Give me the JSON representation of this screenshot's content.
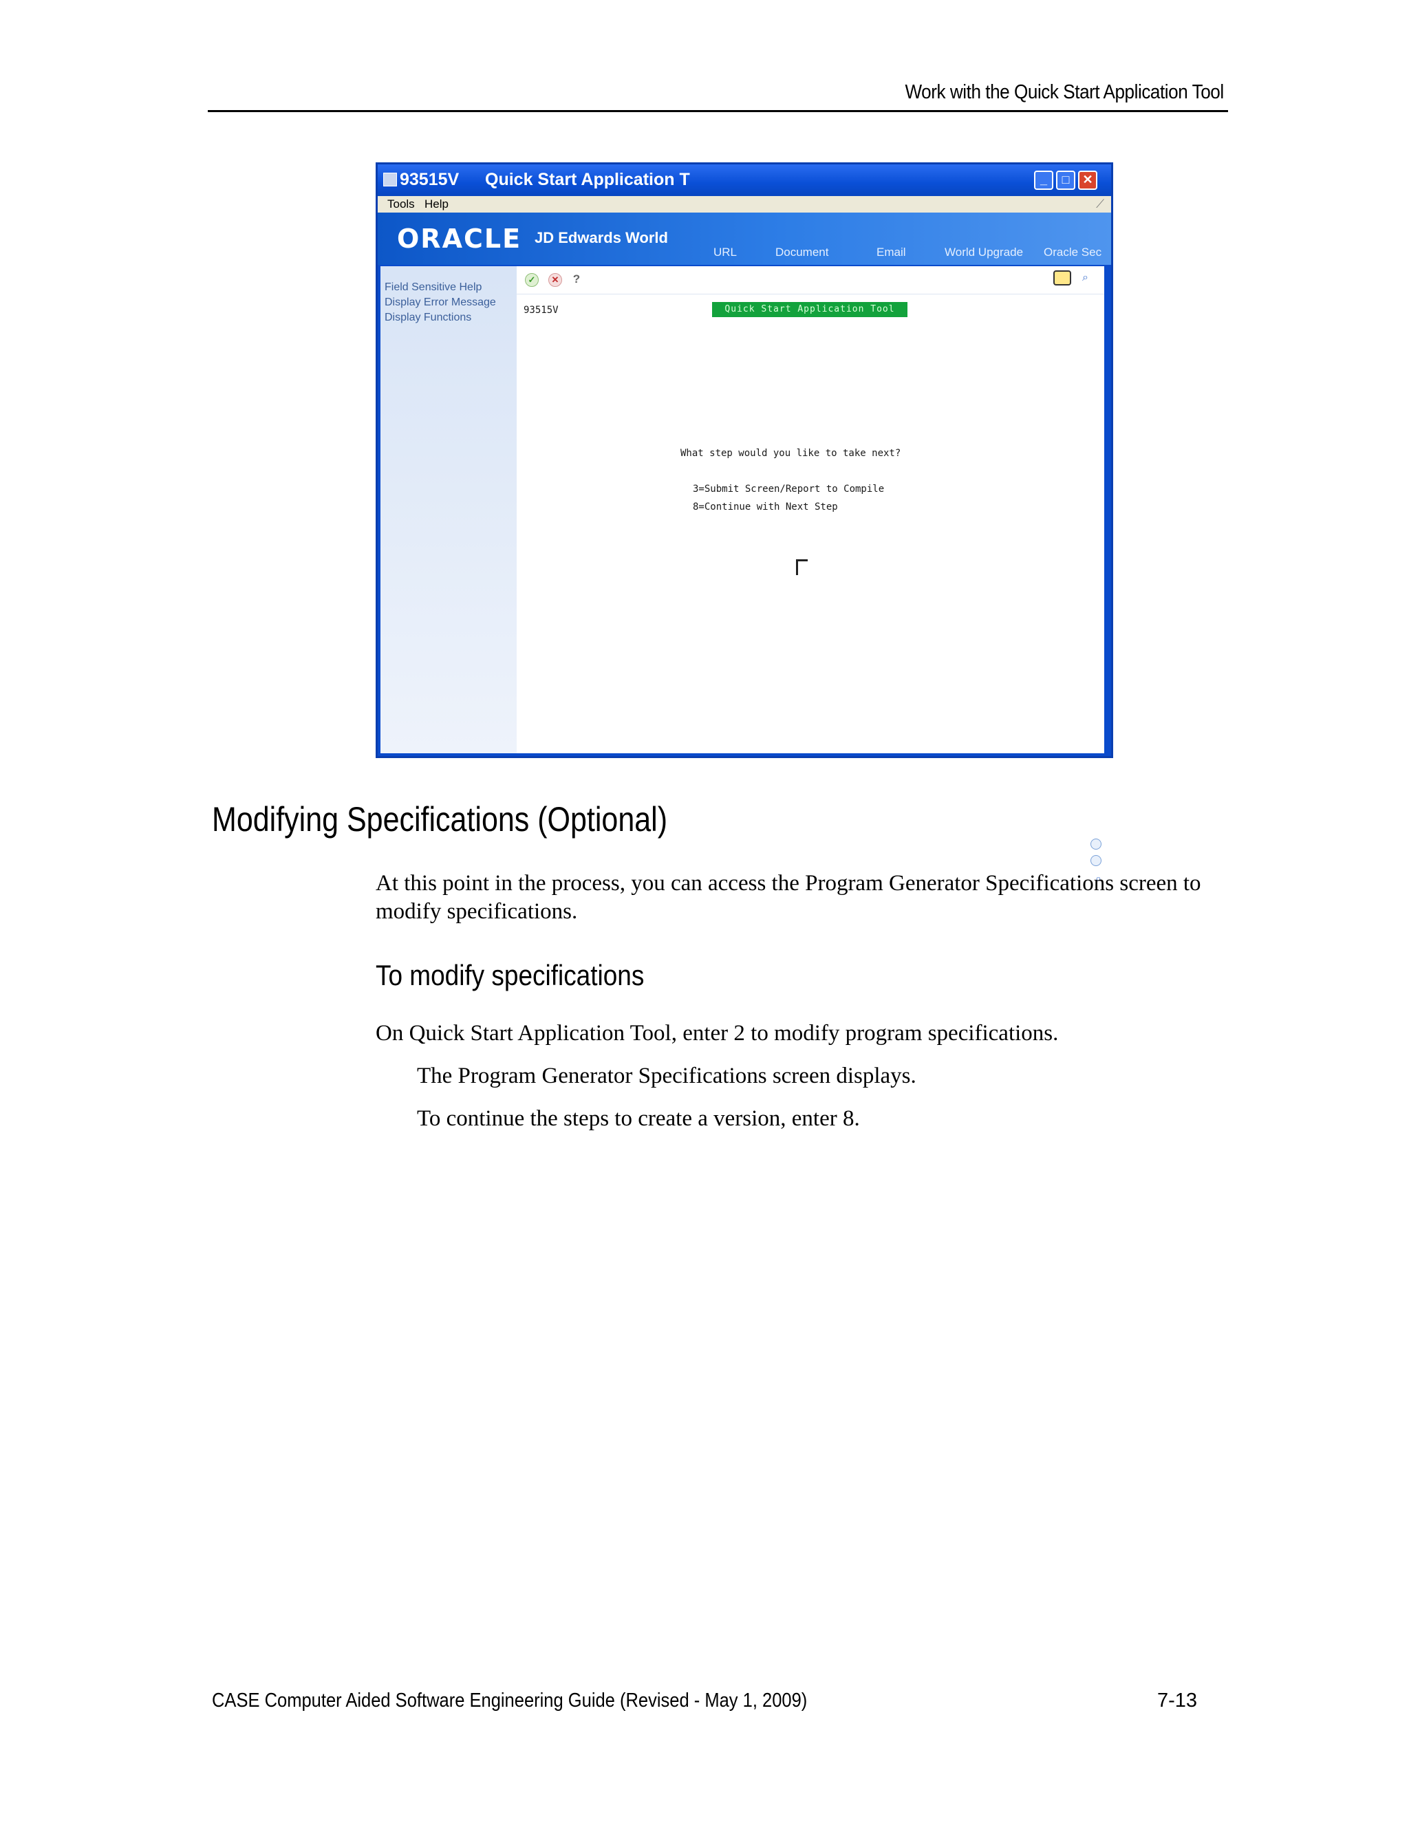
{
  "header": {
    "running_title": "Work with the Quick Start Application Tool"
  },
  "screenshot": {
    "window_id": "93515V",
    "window_title": "Quick Start Application T",
    "menu": [
      "Tools",
      "Help"
    ],
    "brand": {
      "logo": "ORACLE",
      "product": "JD Edwards World"
    },
    "nav_links": [
      "URL",
      "Document",
      "Email",
      "World Upgrade",
      "Oracle Sec"
    ],
    "sidebar": [
      "Field Sensitive Help",
      "Display Error Message",
      "Display Functions"
    ],
    "program_id": "93515V",
    "screen_title": "Quick Start Application Tool",
    "question": "What step would you like to take next?",
    "options": [
      "3=Submit Screen/Report to Compile",
      "8=Continue with Next Step"
    ]
  },
  "section": {
    "title": "Modifying Specifications (Optional)",
    "intro": "At this point in the process, you can access the Program Generator Specifications screen to modify specifications.",
    "subheading": "To modify specifications",
    "step": "On Quick Start Application Tool, enter 2 to modify program specifications.",
    "results": [
      "The Program Generator Specifications screen displays.",
      "To continue the steps to create a version, enter 8."
    ]
  },
  "footer": {
    "left": "CASE Computer Aided Software Engineering Guide (Revised - May 1, 2009)",
    "right": "7-13"
  },
  "icons": {
    "window": "app-icon",
    "minimize": "minimize-icon",
    "maximize": "maximize-icon",
    "close": "close-icon",
    "ok": "checkmark-icon",
    "cancel": "x-icon",
    "help": "question-icon",
    "chat": "speech-bubble-icon",
    "search": "magnifier-icon"
  },
  "colors": {
    "titlebar": "#0a4fd6",
    "screen_title_bg": "#13a23c",
    "close_button": "#d9452c"
  }
}
